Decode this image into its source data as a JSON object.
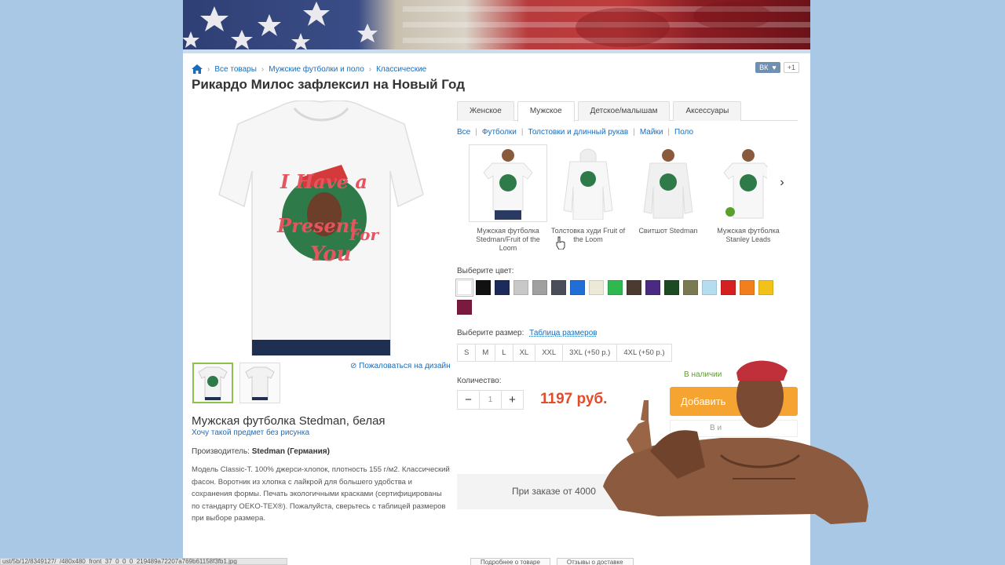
{
  "breadcrumb": {
    "items": [
      "Все товары",
      "Мужские футболки и поло",
      "Классические"
    ]
  },
  "social": {
    "vk": "ВК",
    "plus": "+1"
  },
  "product": {
    "title": "Рикардо Милос зафлексил на Новый Год",
    "print_text": [
      "I Have a",
      "Present",
      "For",
      "You"
    ],
    "name": "Мужская футболка Stedman, белая",
    "no_print_link": "Хочу такой предмет без рисунка",
    "complain": "⊘ Пожаловаться на дизайн",
    "maker_label": "Производитель:",
    "maker_value": "Stedman (Германия)",
    "description": "Модель Classic-T. 100% джерси-хлопок, плотность 155 г/м2. Классический фасон. Воротник из хлопка с лайкрой для большего удобства и сохранения формы. Печать экологичными красками (сертифицированы по стандарту OEKO-TEX®). Пожалуйста, сверьтесь с таблицей размеров при выборе размера."
  },
  "tabs": [
    {
      "label": "Женское",
      "active": false
    },
    {
      "label": "Мужское",
      "active": true
    },
    {
      "label": "Детское/малышам",
      "active": false
    },
    {
      "label": "Аксессуары",
      "active": false
    }
  ],
  "subcategories": [
    "Все",
    "Футболки",
    "Толстовки и длинный рукав",
    "Майки",
    "Поло"
  ],
  "variants": [
    {
      "caption": "Мужская футболка Stedman/Fruit of the Loom",
      "active": true,
      "kind": "tee"
    },
    {
      "caption": "Толстовка худи Fruit of the Loom",
      "active": false,
      "kind": "hoodie"
    },
    {
      "caption": "Свитшот Stedman",
      "active": false,
      "kind": "sweat"
    },
    {
      "caption": "Мужская футболка Stanley Leads",
      "active": false,
      "kind": "tee2"
    }
  ],
  "colors": {
    "label": "Выберите цвет:",
    "swatches": [
      "#ffffff",
      "#111111",
      "#1d2b5a",
      "#c8c8c8",
      "#a0a0a0",
      "#4a4e58",
      "#1f6fd6",
      "#ece9d8",
      "#2eb84f",
      "#4b3a2f",
      "#4a2a82",
      "#1c4a23",
      "#7a7a52",
      "#b6dcef",
      "#d42020",
      "#f27f1d",
      "#f2c21a",
      "#7a1a3f"
    ]
  },
  "sizes": {
    "label": "Выберите размер:",
    "table_link": "Таблица размеров",
    "options": [
      "S",
      "M",
      "L",
      "XL",
      "XXL",
      "3XL (+50 р.)",
      "4XL (+50 р.)"
    ]
  },
  "quantity": {
    "label": "Количество:",
    "minus": "−",
    "value": "1",
    "plus": "+"
  },
  "price": "1197 руб.",
  "stock": "В наличии",
  "add_button": "Добавить",
  "wish_button": "В и",
  "promo": "При заказе от 4000",
  "status_url": "ust/5b/12/8349127/_/480x480_front_37_0_0_0_219489a72207a769b61158f3fb1.jpg",
  "bottom_buttons": [
    "Подробнее о товаре",
    "Отзывы о доставке"
  ]
}
